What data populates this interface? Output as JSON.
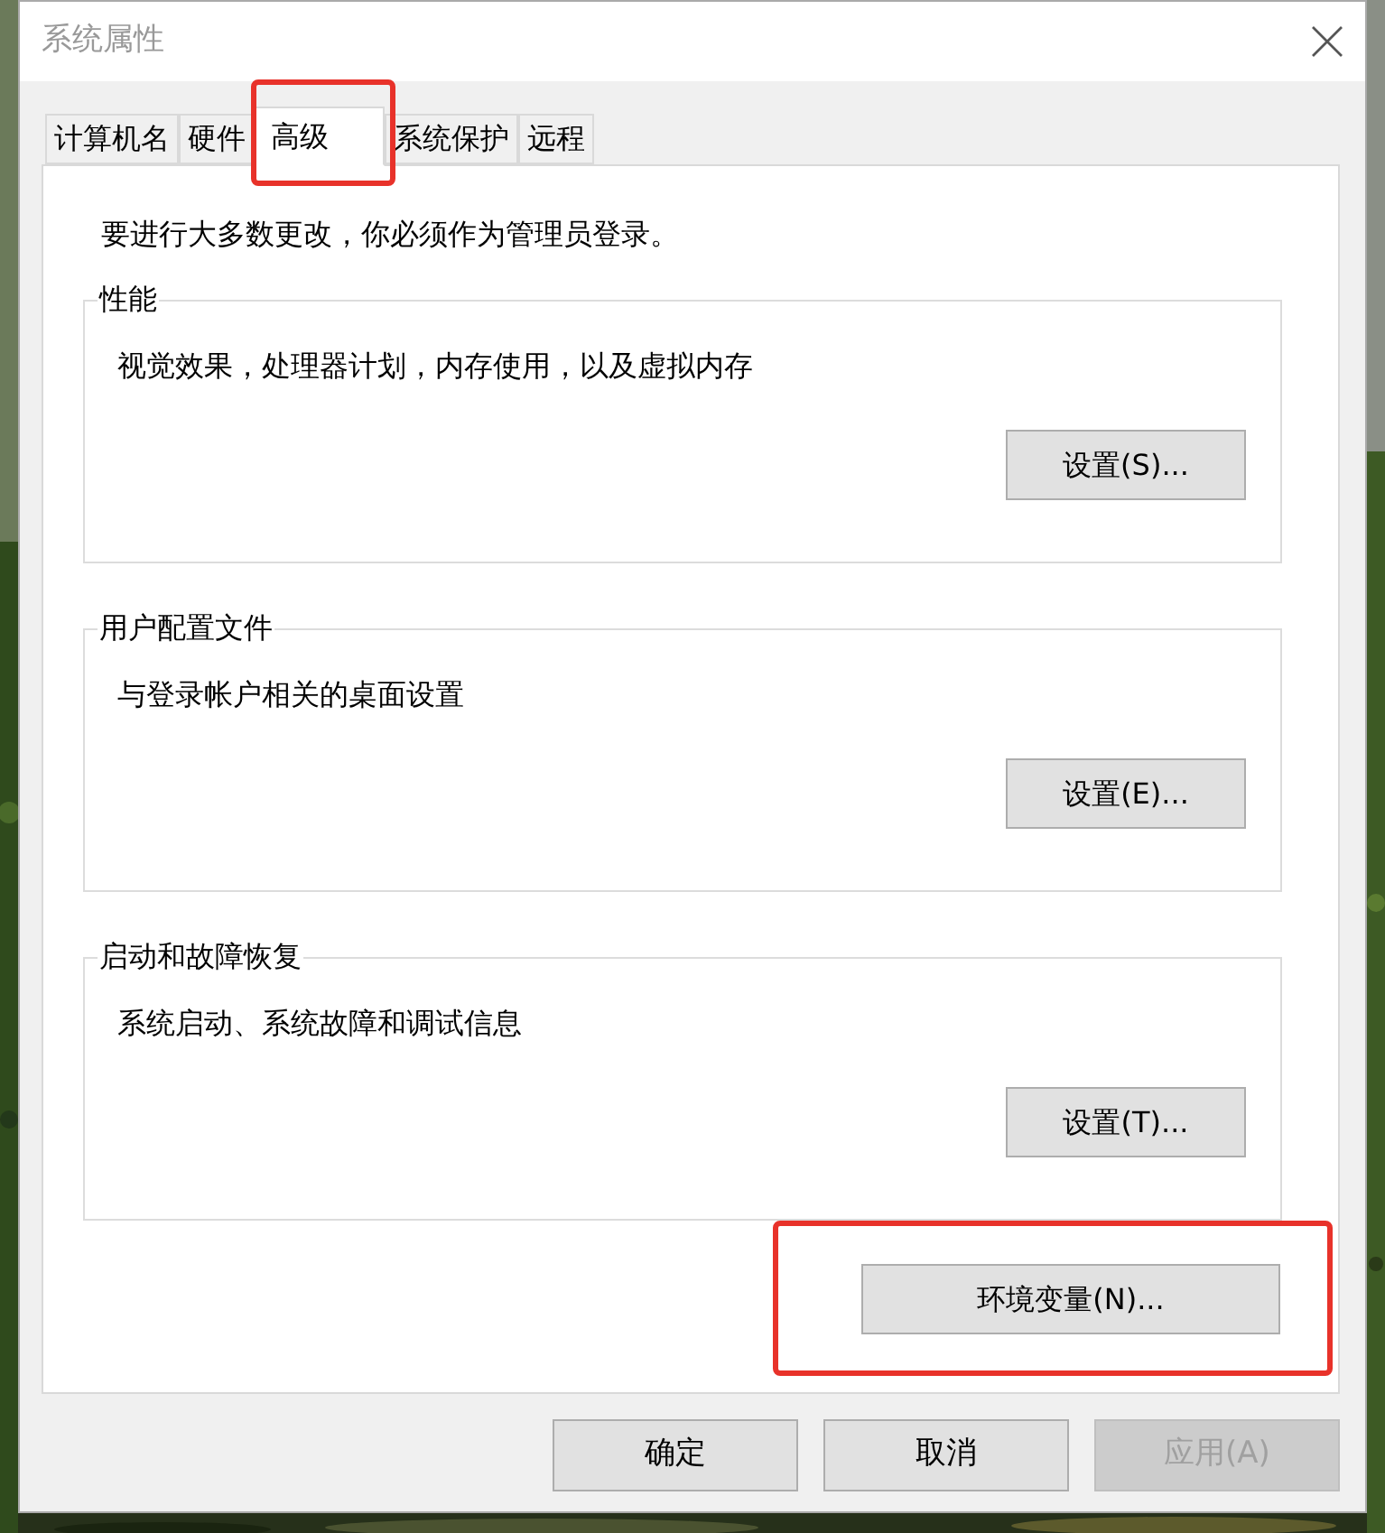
{
  "window": {
    "title": "系统属性"
  },
  "tabs": [
    {
      "label": "计算机名",
      "selected": false,
      "highlighted": false
    },
    {
      "label": "硬件",
      "selected": false,
      "highlighted": false
    },
    {
      "label": "高级",
      "selected": true,
      "highlighted": true
    },
    {
      "label": "系统保护",
      "selected": false,
      "highlighted": false
    },
    {
      "label": "远程",
      "selected": false,
      "highlighted": false
    }
  ],
  "notice": "要进行大多数更改，你必须作为管理员登录。",
  "groups": [
    {
      "title": "性能",
      "description": "视觉效果，处理器计划，内存使用，以及虚拟内存",
      "button": "设置(S)..."
    },
    {
      "title": "用户配置文件",
      "description": "与登录帐户相关的桌面设置",
      "button": "设置(E)..."
    },
    {
      "title": "启动和故障恢复",
      "description": "系统启动、系统故障和调试信息",
      "button": "设置(T)..."
    }
  ],
  "environment_button": {
    "label": "环境变量(N)...",
    "highlighted": true
  },
  "buttons": [
    {
      "label": "确定",
      "disabled": false
    },
    {
      "label": "取消",
      "disabled": false
    },
    {
      "label": "应用(A)",
      "disabled": true
    }
  ]
}
